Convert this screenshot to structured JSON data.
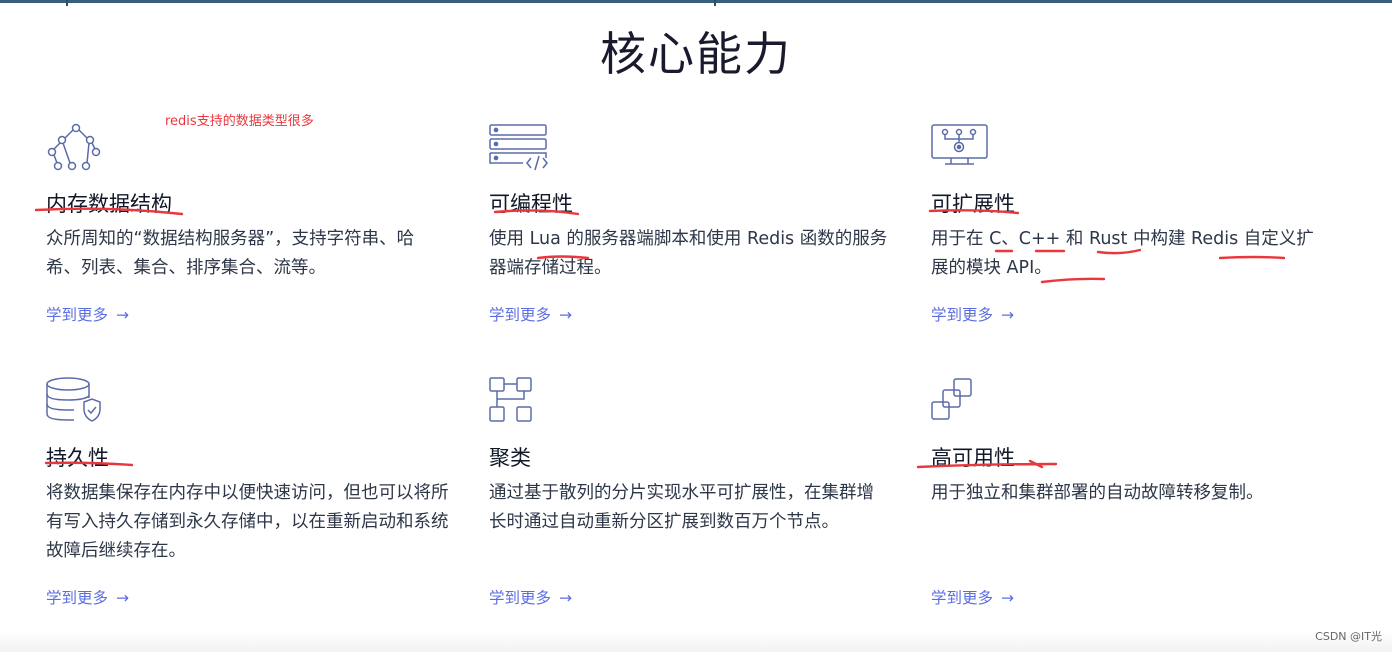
{
  "page": {
    "title": "核心能力",
    "annotation": "redis支持的数据类型很多",
    "watermark": "CSDN @IT光"
  },
  "colors": {
    "title": "#1a1a2e",
    "link": "#5b6ee1",
    "icon": "#5b6ba8",
    "annotation_red": "#e8383d"
  },
  "cards": [
    {
      "icon": "tree-structure-icon",
      "title": "内存数据结构",
      "description": "众所周知的“数据结构服务器”，支持字符串、哈希、列表、集合、排序集合、流等。",
      "link": "学到更多",
      "arrow": "→"
    },
    {
      "icon": "server-code-icon",
      "title": "可编程性",
      "description": "使用 Lua 的服务器端脚本和使用 Redis 函数的服务器端存储过程。",
      "link": "学到更多",
      "arrow": "→"
    },
    {
      "icon": "module-monitor-icon",
      "title": "可扩展性",
      "description": "用于在 C、C++ 和 Rust 中构建 Redis 自定义扩展的模块 API。",
      "link": "学到更多",
      "arrow": "→"
    },
    {
      "icon": "database-shield-icon",
      "title": "持久性",
      "description": "将数据集保存在内存中以便快速访问，但也可以将所有写入持久存储到永久存储中，以在重新启动和系统故障后继续存在。",
      "link": "学到更多",
      "arrow": "→"
    },
    {
      "icon": "cluster-nodes-icon",
      "title": "聚类",
      "description": "通过基于散列的分片实现水平可扩展性，在集群增长时通过自动重新分区扩展到数百万个节点。",
      "link": "学到更多",
      "arrow": "→"
    },
    {
      "icon": "stacked-squares-icon",
      "title": "高可用性",
      "description": "用于独立和集群部署的自动故障转移复制。",
      "link": "学到更多",
      "arrow": "→"
    }
  ]
}
